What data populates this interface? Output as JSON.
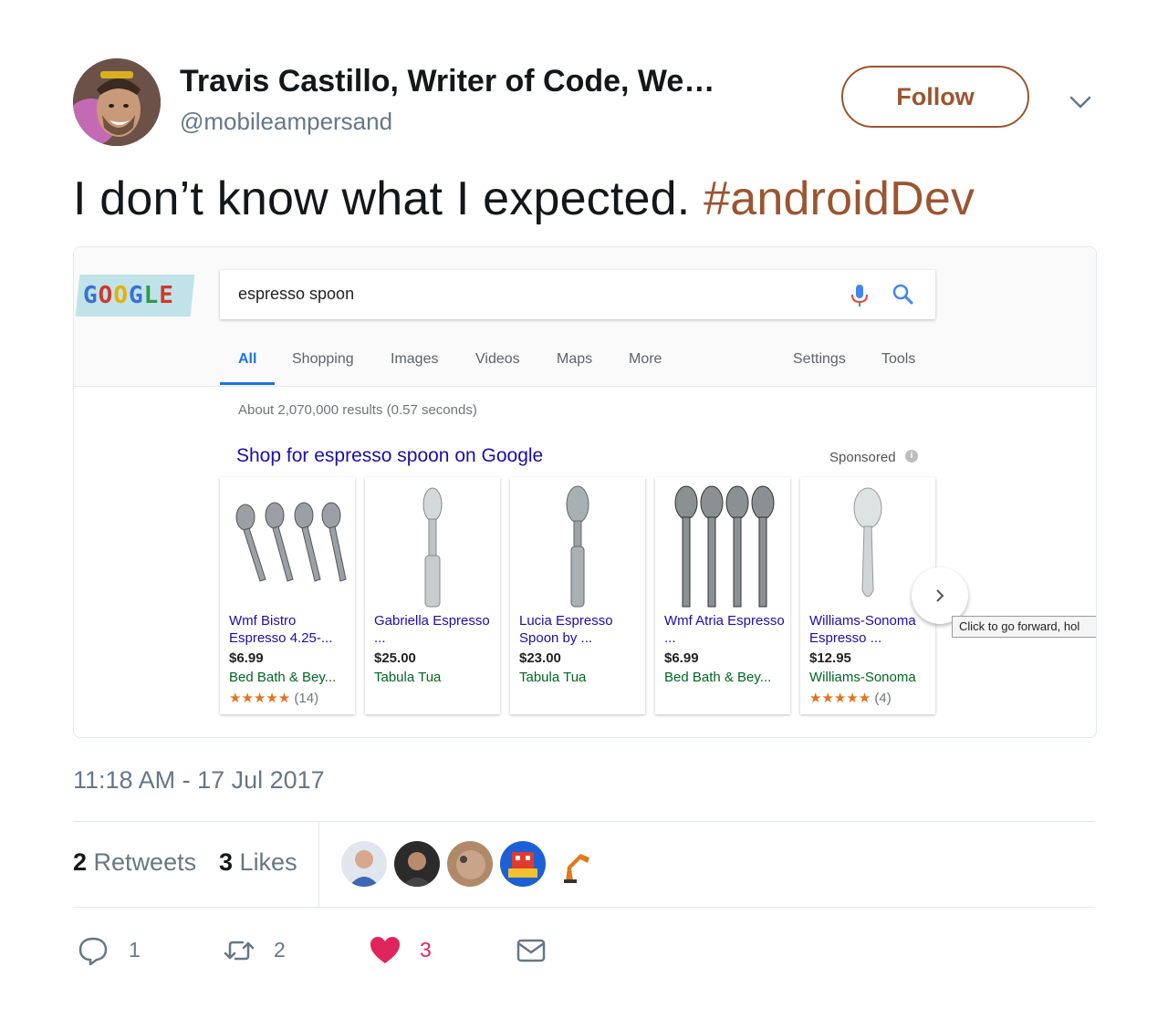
{
  "author": {
    "name": "Travis Castillo, Writer of Code, We…",
    "handle": "@mobileampersand",
    "avatar_icon": "user-avatar-photo"
  },
  "follow_label": "Follow",
  "tweet": {
    "text": "I don’t know what I expected. ",
    "hashtag": "#androidDev"
  },
  "screenshot": {
    "logo_text": "GOOGLE",
    "search_value": "espresso spoon",
    "nav": {
      "all": "All",
      "shopping": "Shopping",
      "images": "Images",
      "videos": "Videos",
      "maps": "Maps",
      "more": "More",
      "settings": "Settings",
      "tools": "Tools"
    },
    "results_count": "About 2,070,000 results (0.57 seconds)",
    "shop_heading": "Shop for espresso spoon on Google",
    "sponsored": "Sponsored",
    "tooltip": "Click to go forward, hol",
    "products": [
      {
        "title": "Wmf Bistro Espresso 4.25-...",
        "price": "$6.99",
        "store": "Bed Bath & Bey...",
        "stars": "★★★★★",
        "reviews": "(14)"
      },
      {
        "title": "Gabriella Espresso ...",
        "price": "$25.00",
        "store": "Tabula Tua"
      },
      {
        "title": "Lucia Espresso Spoon by ...",
        "price": "$23.00",
        "store": "Tabula Tua"
      },
      {
        "title": "Wmf Atria Espresso ...",
        "price": "$6.99",
        "store": "Bed Bath & Bey..."
      },
      {
        "title": "Williams-Sonoma Espresso ...",
        "price": "$12.95",
        "store": "Williams-Sonoma",
        "stars": "★★★★★",
        "reviews": "(4)"
      }
    ]
  },
  "timestamp": "11:18 AM - 17 Jul 2017",
  "stats": {
    "retweets_count": "2",
    "retweets_label": "Retweets",
    "likes_count": "3",
    "likes_label": "Likes"
  },
  "actions": {
    "reply_count": "1",
    "retweet_count": "2",
    "like_count": "3"
  },
  "colors": {
    "accent": "#9b5530",
    "like_red": "#e0245e",
    "link_blue": "#1a0dab",
    "google_blue": "#1a73e8"
  }
}
